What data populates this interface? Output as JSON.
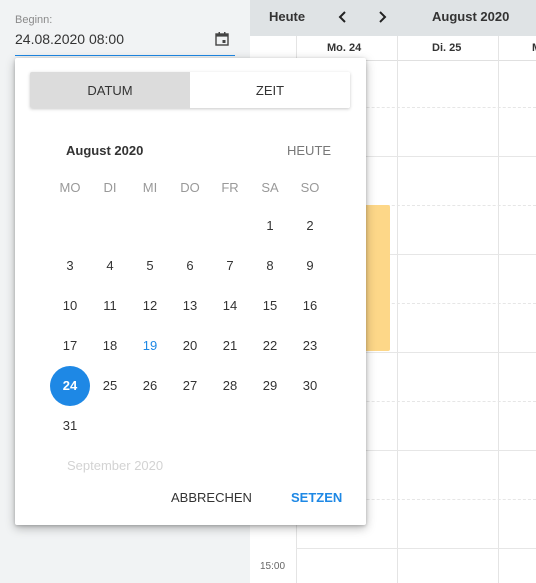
{
  "form": {
    "label": "Beginn:",
    "value": "24.08.2020 08:00"
  },
  "calendar": {
    "toolbar": {
      "today": "Heute",
      "prev_icon": "chevron-left-icon",
      "next_icon": "chevron-right-icon",
      "title": "August 2020"
    },
    "columns": [
      "Mo. 24",
      "Di. 25",
      "M"
    ],
    "time_label": "15:00",
    "event_color": "#fdd788"
  },
  "picker": {
    "tabs": {
      "date": "DATUM",
      "time": "ZEIT"
    },
    "month_title": "August 2020",
    "today_link": "HEUTE",
    "weekdays": [
      "MO",
      "DI",
      "MI",
      "DO",
      "FR",
      "SA",
      "SO"
    ],
    "weeks": [
      [
        "",
        "",
        "",
        "",
        "",
        "1",
        "2"
      ],
      [
        "3",
        "4",
        "5",
        "6",
        "7",
        "8",
        "9"
      ],
      [
        "10",
        "11",
        "12",
        "13",
        "14",
        "15",
        "16"
      ],
      [
        "17",
        "18",
        "19",
        "20",
        "21",
        "22",
        "23"
      ],
      [
        "24",
        "25",
        "26",
        "27",
        "28",
        "29",
        "30"
      ],
      [
        "31",
        "",
        "",
        "",
        "",
        "",
        ""
      ]
    ],
    "today_day": "19",
    "selected_day": "24",
    "next_month": "September 2020",
    "cancel": "ABBRECHEN",
    "set": "SETZEN",
    "accent_color": "#1e88e5"
  }
}
